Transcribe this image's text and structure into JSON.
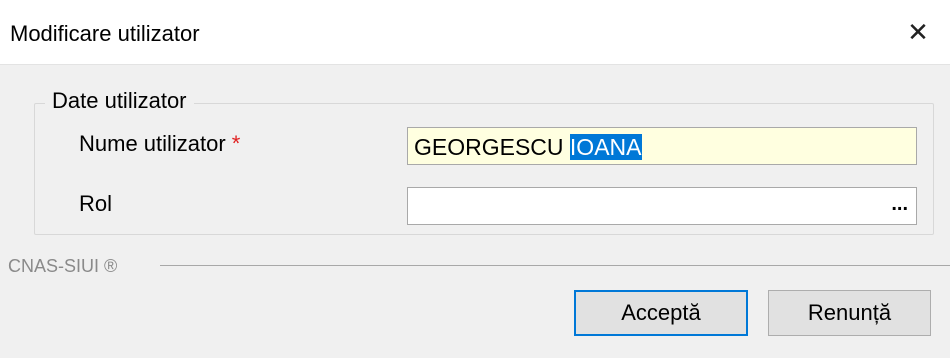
{
  "window": {
    "title": "Modificare utilizator",
    "close_glyph": "✕"
  },
  "group": {
    "legend": "Date utilizator",
    "fields": {
      "name": {
        "label": "Nume utilizator",
        "required_mark": "*",
        "value_unselected": "GEORGESCU ",
        "value_selected": "IOANA"
      },
      "rol": {
        "label": "Rol",
        "value": "",
        "lookup_label": "..."
      }
    }
  },
  "footer": {
    "brand": "CNAS-SIUI ®"
  },
  "buttons": {
    "accept": "Acceptă",
    "cancel": "Renunță"
  },
  "colors": {
    "input_highlight": "#ffffe0",
    "selection": "#0078d7",
    "required": "#e02020"
  }
}
